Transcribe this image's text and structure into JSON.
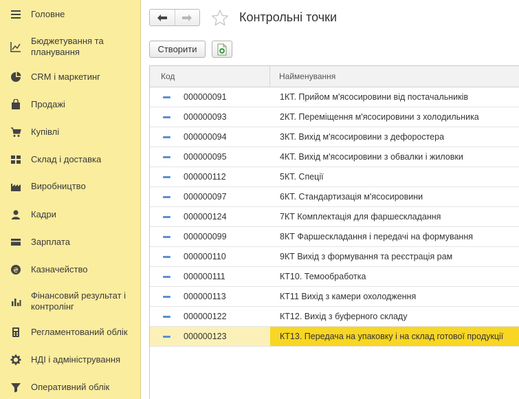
{
  "colors": {
    "sidebar_bg": "#fbed9e",
    "selected_row": "#fbf1b8",
    "selected_cell": "#f8d623",
    "row_marker": "#5b8fd0"
  },
  "sidebar": {
    "items": [
      {
        "label": "Головне",
        "icon": "menu-icon"
      },
      {
        "label": "Бюджетування та планування",
        "icon": "chart-line-icon"
      },
      {
        "label": "CRM і маркетинг",
        "icon": "pie-chart-icon"
      },
      {
        "label": "Продажі",
        "icon": "shopping-bag-icon"
      },
      {
        "label": "Купівлі",
        "icon": "cart-icon"
      },
      {
        "label": "Склад і доставка",
        "icon": "grid-icon"
      },
      {
        "label": "Виробництво",
        "icon": "factory-icon"
      },
      {
        "label": "Кадри",
        "icon": "person-icon"
      },
      {
        "label": "Зарплата",
        "icon": "card-icon"
      },
      {
        "label": "Казначейство",
        "icon": "coin-icon"
      },
      {
        "label": "Фінансовий результат і контролінг",
        "icon": "bar-chart-icon"
      },
      {
        "label": "Регламентований облік",
        "icon": "calculator-icon"
      },
      {
        "label": "НДІ і адміністрування",
        "icon": "gear-icon"
      },
      {
        "label": "Оперативний облік",
        "icon": "funnel-icon"
      }
    ]
  },
  "header": {
    "title": "Контрольні точки"
  },
  "toolbar": {
    "create_label": "Створити"
  },
  "table": {
    "columns": [
      "Код",
      "Найменування"
    ],
    "rows": [
      {
        "code": "000000091",
        "name": "1КТ. Прийом м'ясосировини від постачальників"
      },
      {
        "code": "000000093",
        "name": "2КТ. Переміщення м'ясосировини з холодильника"
      },
      {
        "code": "000000094",
        "name": "3КТ. Вихід м'ясосировини з дефоростера"
      },
      {
        "code": "000000095",
        "name": "4КТ. Вихід м'ясосировини з обвалки і жиловки"
      },
      {
        "code": "000000112",
        "name": "5КТ. Спеції"
      },
      {
        "code": "000000097",
        "name": "6КТ. Стандартизація м'ясосировини"
      },
      {
        "code": "000000124",
        "name": "7КТ Комплектація для фаршескладання"
      },
      {
        "code": "000000099",
        "name": "8КТ Фаршескладання і передачі на формування"
      },
      {
        "code": "000000110",
        "name": "9КТ Вихід з формування та реєстрація рам"
      },
      {
        "code": "000000111",
        "name": "КТ10. Темообработка"
      },
      {
        "code": "000000113",
        "name": "КТ11 Вихід з камери охолодження"
      },
      {
        "code": "000000122",
        "name": "КТ12. Вихід з буферного складу"
      },
      {
        "code": "000000123",
        "name": "КТ13. Передача на упаковку і на склад готової продукції"
      }
    ],
    "selected_index": 12
  }
}
